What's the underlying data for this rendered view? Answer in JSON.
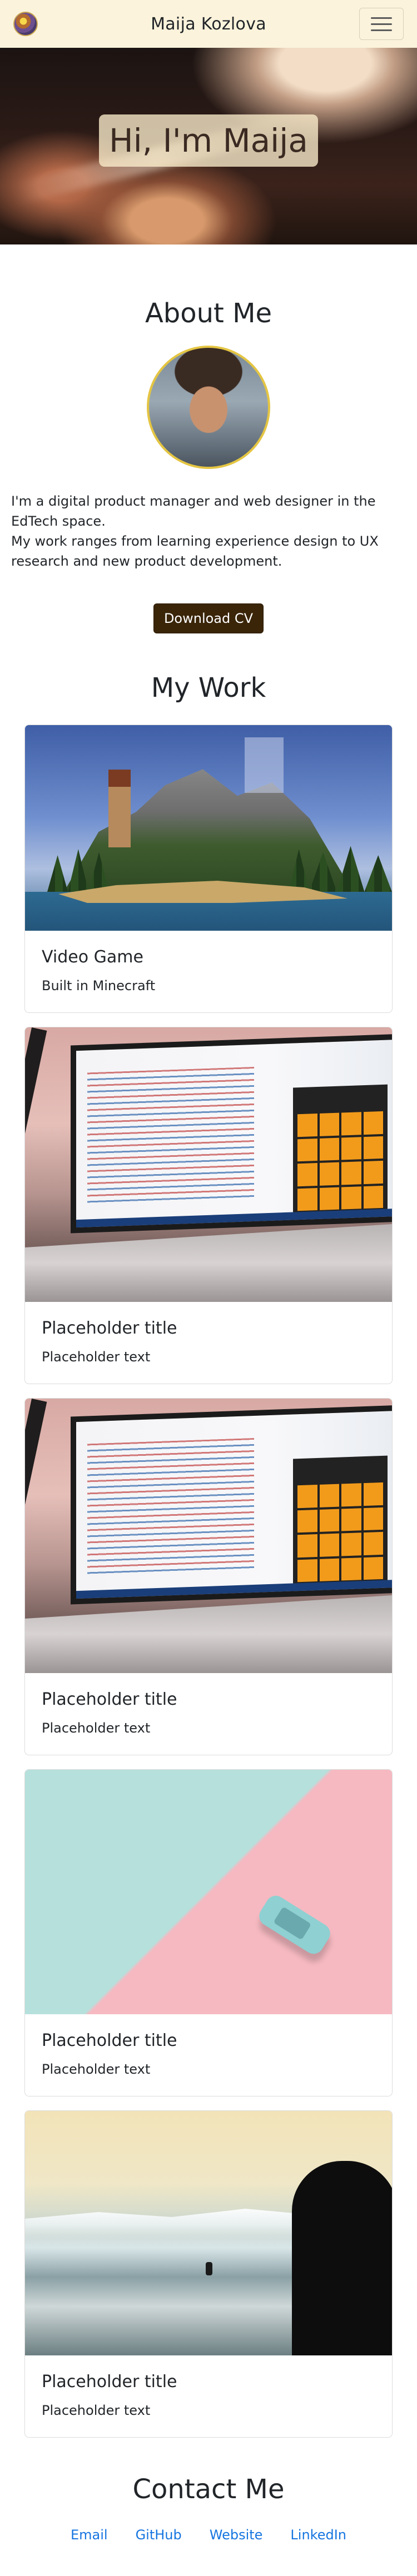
{
  "navbar": {
    "brand_name": "Maija Kozlova"
  },
  "hero": {
    "title": "Hi, I'm Maija"
  },
  "about": {
    "title": "About Me",
    "paragraph_1": "I'm a digital product manager and web designer in the EdTech space.",
    "paragraph_2": "My work ranges from learning experience design to UX research and new product development.",
    "cv_button_label": "Download CV"
  },
  "work": {
    "title": "My Work",
    "cards": [
      {
        "title": "Video Game",
        "text": "Built in Minecraft"
      },
      {
        "title": "Placeholder title",
        "text": "Placeholder text"
      },
      {
        "title": "Placeholder title",
        "text": "Placeholder text"
      },
      {
        "title": "Placeholder title",
        "text": "Placeholder text"
      },
      {
        "title": "Placeholder title",
        "text": "Placeholder text"
      }
    ]
  },
  "contact": {
    "title": "Contact Me",
    "links": [
      "Email",
      "GitHub",
      "Website",
      "LinkedIn"
    ]
  },
  "colors": {
    "navbar_bg": "#fbf3dc",
    "button_bg": "#3a2508",
    "link": "#1675e0",
    "avatar_border": "#e4c542"
  },
  "icons": {
    "menu": "hamburger-icon"
  }
}
